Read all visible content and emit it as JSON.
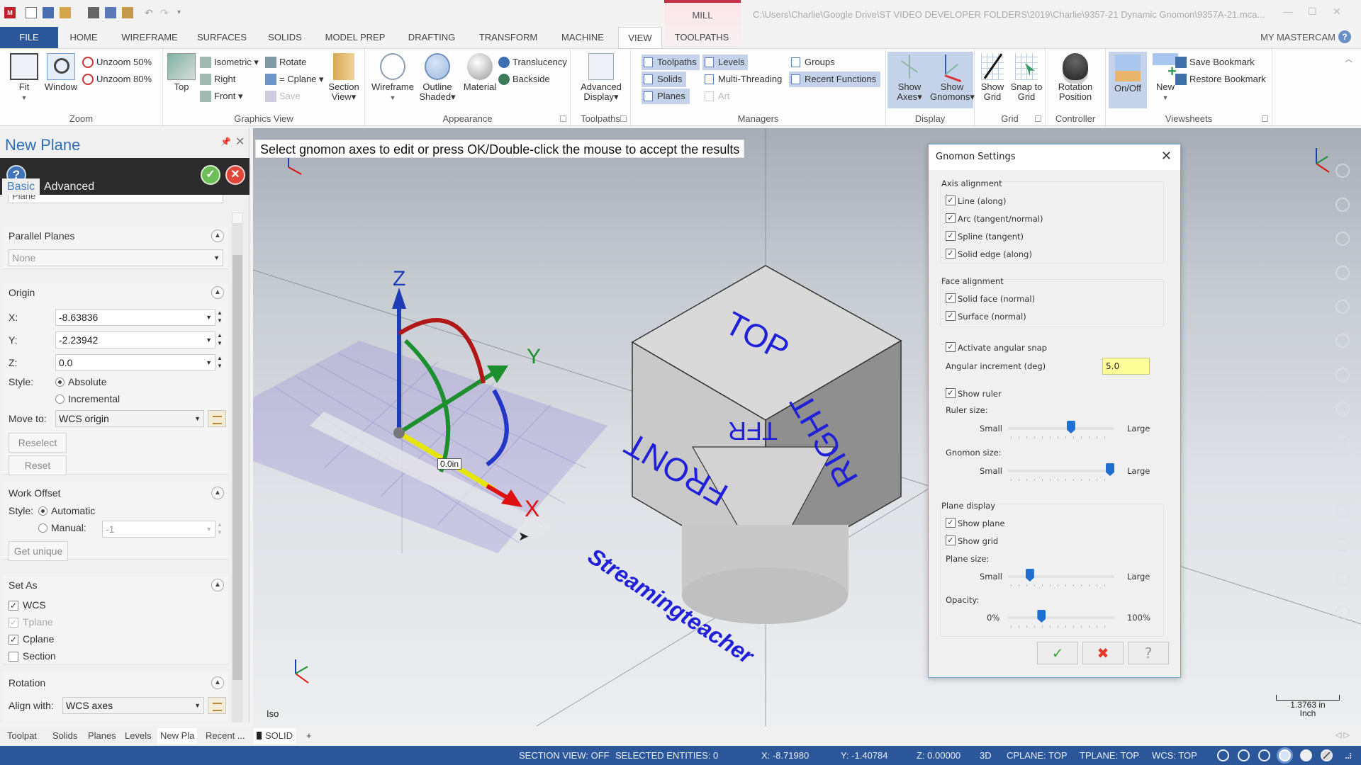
{
  "titlebar": {
    "context_tab": "MILL",
    "file_path": "C:\\Users\\Charlie\\Google Drive\\ST VIDEO DEVELOPER FOLDERS\\2019\\Charlie\\9357-21 Dynamic Gnomon\\9357A-21.mca...",
    "quick_access": [
      "new-file-icon",
      "save-icon",
      "open-icon",
      "print-icon",
      "save-as-icon",
      "folder-icon",
      "undo-icon",
      "redo-icon",
      "customize-icon"
    ]
  },
  "ribbon_tabs": [
    "FILE",
    "HOME",
    "WIREFRAME",
    "SURFACES",
    "SOLIDS",
    "MODEL PREP",
    "DRAFTING",
    "TRANSFORM",
    "MACHINE",
    "VIEW",
    "TOOLPATHS"
  ],
  "active_tab": "VIEW",
  "account": "MY MASTERCAM",
  "ribbon": {
    "zoom": {
      "label": "Zoom",
      "fit": "Fit",
      "window": "Window",
      "unzoom50": "Unzoom 50%",
      "unzoom80": "Unzoom 80%"
    },
    "graphics_view": {
      "label": "Graphics View",
      "top": "Top",
      "isometric": "Isometric",
      "right": "Right",
      "front": "Front",
      "rotate": "Rotate",
      "cplane": "= Cplane",
      "save": "Save",
      "section_view": "Section View"
    },
    "appearance": {
      "label": "Appearance",
      "wireframe": "Wireframe",
      "outline_shaded": "Outline Shaded",
      "material": "Material",
      "translucency": "Translucency",
      "backside": "Backside"
    },
    "toolpaths": {
      "label": "Toolpaths",
      "advanced_display": "Advanced Display"
    },
    "managers": {
      "label": "Managers",
      "items": [
        "Toolpaths",
        "Levels",
        "Groups",
        "Solids",
        "Multi-Threading",
        "Recent Functions",
        "Planes",
        "Art"
      ]
    },
    "display": {
      "label": "Display",
      "show_axes": "Show Axes",
      "show_gnomons": "Show Gnomons"
    },
    "grid": {
      "label": "Grid",
      "show_grid": "Show Grid",
      "snap_to_grid": "Snap to Grid"
    },
    "controller": {
      "label": "Controller",
      "rotation_position": "Rotation Position"
    },
    "viewsheets": {
      "label": "Viewsheets",
      "on_off": "On/Off",
      "new": "New",
      "save_bookmark": "Save Bookmark",
      "restore_bookmark": "Restore Bookmark"
    }
  },
  "left_panel": {
    "title": "New Plane",
    "tabs": [
      "Basic",
      "Advanced"
    ],
    "partial_field": "Plane",
    "parallel_planes": {
      "title": "Parallel Planes",
      "value": "None"
    },
    "origin": {
      "title": "Origin",
      "x_label": "X:",
      "x": "-8.63836",
      "y_label": "Y:",
      "y": "-2.23942",
      "z_label": "Z:",
      "z": "0.0",
      "style_label": "Style:",
      "style_options": [
        "Absolute",
        "Incremental"
      ],
      "style_selected": "Absolute",
      "move_to_label": "Move to:",
      "move_to": "WCS origin",
      "reselect": "Reselect",
      "reset": "Reset"
    },
    "work_offset": {
      "title": "Work Offset",
      "style_label": "Style:",
      "automatic": "Automatic",
      "manual": "Manual:",
      "manual_value": "-1",
      "selected": "Automatic",
      "get_unique": "Get unique"
    },
    "set_as": {
      "title": "Set As",
      "items": [
        {
          "label": "WCS",
          "checked": true,
          "enabled": true
        },
        {
          "label": "Tplane",
          "checked": true,
          "enabled": false
        },
        {
          "label": "Cplane",
          "checked": true,
          "enabled": true
        },
        {
          "label": "Section",
          "checked": false,
          "enabled": true
        }
      ]
    },
    "rotation": {
      "title": "Rotation",
      "align_label": "Align with:",
      "align_value": "WCS axes"
    }
  },
  "viewport": {
    "prompt": "Select gnomon axes to edit or press OK/Double-click the mouse to accept the results",
    "view_name": "Iso",
    "ruler_readout": "0.0in",
    "scale_value": "1.3763 in",
    "scale_unit": "Inch",
    "cube_faces": [
      "TOP",
      "FRONT",
      "RIGHT",
      "TFR"
    ],
    "watermark": "Streamingteacher",
    "axis_labels": {
      "x": "X",
      "y": "Y",
      "z": "Z"
    }
  },
  "gnomon_dialog": {
    "title": "Gnomon Settings",
    "axis_alignment": {
      "title": "Axis alignment",
      "items": [
        {
          "label": "Line (along)",
          "checked": true
        },
        {
          "label": "Arc (tangent/normal)",
          "checked": true
        },
        {
          "label": "Spline (tangent)",
          "checked": true
        },
        {
          "label": "Solid edge (along)",
          "checked": true
        }
      ]
    },
    "face_alignment": {
      "title": "Face alignment",
      "items": [
        {
          "label": "Solid face (normal)",
          "checked": true
        },
        {
          "label": "Surface (normal)",
          "checked": true
        }
      ]
    },
    "angular_snap": {
      "label": "Activate angular snap",
      "checked": true
    },
    "angular_increment": {
      "label": "Angular increment (deg)",
      "value": "5.0"
    },
    "show_ruler": {
      "label": "Show ruler",
      "checked": true
    },
    "ruler_size": {
      "label": "Ruler size:",
      "min": "Small",
      "max": "Large",
      "value": 0.6
    },
    "gnomon_size": {
      "label": "Gnomon size:",
      "min": "Small",
      "max": "Large",
      "value": 1.0
    },
    "plane_display": {
      "title": "Plane display",
      "items": [
        {
          "label": "Show plane",
          "checked": true
        },
        {
          "label": "Show grid",
          "checked": true
        }
      ]
    },
    "plane_size": {
      "label": "Plane size:",
      "min": "Small",
      "max": "Large",
      "value": 0.18
    },
    "opacity": {
      "label": "Opacity:",
      "min": "0%",
      "max": "100%",
      "value": 0.3
    },
    "buttons": [
      "ok",
      "cancel",
      "help"
    ]
  },
  "bottom_tabs": [
    "Toolpat",
    "Solids",
    "Planes",
    "Levels",
    "New Pla",
    "Recent ...",
    "SOLID",
    "+"
  ],
  "active_bottom_tab": "New Pla",
  "status": {
    "section_view": "SECTION VIEW: OFF",
    "selected": "SELECTED ENTITIES: 0",
    "x": "X:  -8.71980",
    "y": "Y:  -1.40784",
    "z": "Z:  0.00000",
    "mode": "3D",
    "cplane": "CPLANE: TOP",
    "tplane": "TPLANE: TOP",
    "wcs": "WCS: TOP"
  }
}
